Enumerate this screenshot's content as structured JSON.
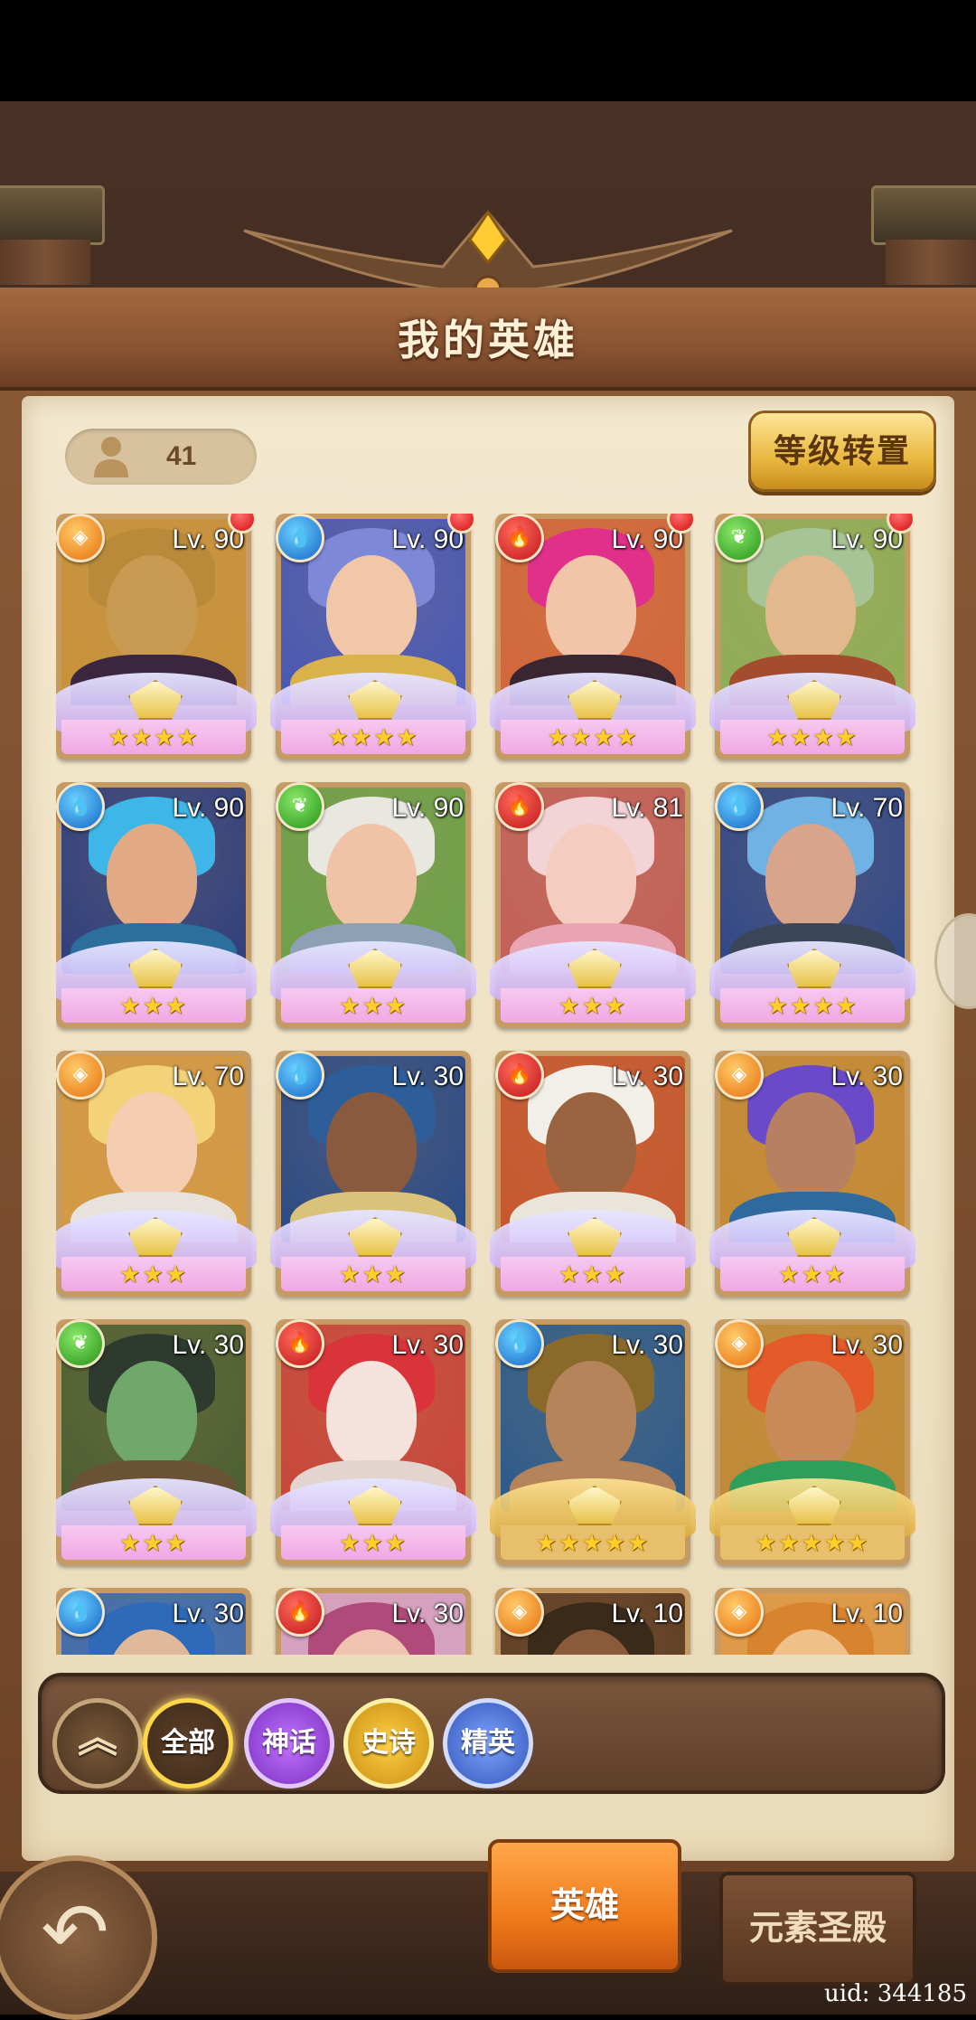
{
  "header": {
    "title": "我的英雄"
  },
  "hero_count": "41",
  "convert_button": "等级转置",
  "heroes": [
    {
      "level": "Lv. 90",
      "element": "light",
      "stars": "★★★★",
      "frame": "pink",
      "notify": true,
      "hair": "#b88a3a",
      "skin": "#c99a52",
      "body": "#3b2640",
      "bg": "#c8923a"
    },
    {
      "level": "Lv. 90",
      "element": "water",
      "stars": "★★★★",
      "frame": "pink",
      "notify": true,
      "hair": "#7e88d8",
      "skin": "#f1c7a8",
      "body": "#d9b24a",
      "bg": "#4658b5"
    },
    {
      "level": "Lv. 90",
      "element": "fire",
      "stars": "★★★★",
      "frame": "pink",
      "notify": true,
      "hair": "#e0308a",
      "skin": "#f3c5a8",
      "body": "#3a2630",
      "bg": "#d2663a"
    },
    {
      "level": "Lv. 90",
      "element": "nature",
      "stars": "★★★★",
      "frame": "pink",
      "notify": true,
      "hair": "#a6c496",
      "skin": "#e3b88c",
      "body": "#a44d2e",
      "bg": "#8fae58"
    },
    {
      "level": "Lv. 90",
      "element": "water",
      "stars": "★★★",
      "frame": "pink",
      "notify": false,
      "hair": "#3fb6e8",
      "skin": "#e2a985",
      "body": "#2c6e9c",
      "bg": "#2e3f7e"
    },
    {
      "level": "Lv. 90",
      "element": "nature",
      "stars": "★★★",
      "frame": "pink",
      "notify": false,
      "hair": "#e8e8e0",
      "skin": "#f0c3a6",
      "body": "#8ea0b5",
      "bg": "#6ca04a"
    },
    {
      "level": "Lv. 81",
      "element": "fire",
      "stars": "★★★",
      "frame": "pink",
      "notify": false,
      "hair": "#f2d3d6",
      "skin": "#f5ccc0",
      "body": "#e9a4b4",
      "bg": "#c2605a"
    },
    {
      "level": "Lv. 70",
      "element": "water",
      "stars": "★★★★",
      "frame": "pink",
      "notify": false,
      "hair": "#6fb2e3",
      "skin": "#d8a58c",
      "body": "#3a4658",
      "bg": "#2f4788"
    },
    {
      "level": "Lv. 70",
      "element": "light",
      "stars": "★★★",
      "frame": "pink",
      "notify": false,
      "hair": "#f4d27a",
      "skin": "#f5cdb0",
      "body": "#e8e2dc",
      "bg": "#d49a44"
    },
    {
      "level": "Lv. 30",
      "element": "water",
      "stars": "★★★",
      "frame": "pink",
      "notify": false,
      "hair": "#2e5e9a",
      "skin": "#8a5a3e",
      "body": "#d9c27a",
      "bg": "#2a4a86"
    },
    {
      "level": "Lv. 30",
      "element": "fire",
      "stars": "★★★",
      "frame": "pink",
      "notify": false,
      "hair": "#f2efe8",
      "skin": "#9a6440",
      "body": "#eae5da",
      "bg": "#c6562e"
    },
    {
      "level": "Lv. 30",
      "element": "light",
      "stars": "★★★",
      "frame": "pink",
      "notify": false,
      "hair": "#6a4ac8",
      "skin": "#b78060",
      "body": "#2e6a9e",
      "bg": "#c48a34"
    },
    {
      "level": "Lv. 30",
      "element": "nature",
      "stars": "★★★",
      "frame": "pink",
      "notify": false,
      "hair": "#2e3a2e",
      "skin": "#6fa86a",
      "body": "#6a5236",
      "bg": "#4a5e32"
    },
    {
      "level": "Lv. 30",
      "element": "fire",
      "stars": "★★★",
      "frame": "pink",
      "notify": false,
      "hair": "#d8343a",
      "skin": "#f6e2dc",
      "body": "#e4d4d0",
      "bg": "#c7453a"
    },
    {
      "level": "Lv. 30",
      "element": "water",
      "stars": "★★★★★",
      "frame": "gold",
      "notify": false,
      "hair": "#8a6a2a",
      "skin": "#b5845a",
      "body": "#b5845a",
      "bg": "#2b5a8c"
    },
    {
      "level": "Lv. 30",
      "element": "light",
      "stars": "★★★★★",
      "frame": "gold",
      "notify": false,
      "hair": "#e45a2a",
      "skin": "#c98a5a",
      "body": "#2e9e5a",
      "bg": "#c08a36"
    },
    {
      "level": "Lv. 30",
      "element": "water",
      "stars": "",
      "frame": "pink",
      "notify": false,
      "hair": "#2e6ab8",
      "skin": "#e0b89a",
      "body": "#3a5a8a",
      "bg": "#3a6ab0"
    },
    {
      "level": "Lv. 30",
      "element": "fire",
      "stars": "",
      "frame": "pink",
      "notify": false,
      "hair": "#b04a7a",
      "skin": "#f0c3b0",
      "body": "#8a4a6a",
      "bg": "#d7a2c8"
    },
    {
      "level": "Lv. 10",
      "element": "light",
      "stars": "",
      "frame": "gold",
      "notify": false,
      "hair": "#3a2a1a",
      "skin": "#8a5a3a",
      "body": "#5a3a2a",
      "bg": "#5a3a22"
    },
    {
      "level": "Lv. 10",
      "element": "light",
      "stars": "",
      "frame": "gold",
      "notify": false,
      "hair": "#d8842e",
      "skin": "#f0c08a",
      "body": "#b06a2a",
      "bg": "#e09a46"
    }
  ],
  "element_icons": {
    "fire": "fire-icon",
    "water": "water-drop-icon",
    "nature": "leaf-icon",
    "light": "light-icon"
  },
  "filters": {
    "all": "全部",
    "myth": "神话",
    "epic": "史诗",
    "elite": "精英"
  },
  "tabs": {
    "heroes": "英雄",
    "temple": "元素圣殿"
  },
  "uid": "uid: 344185"
}
